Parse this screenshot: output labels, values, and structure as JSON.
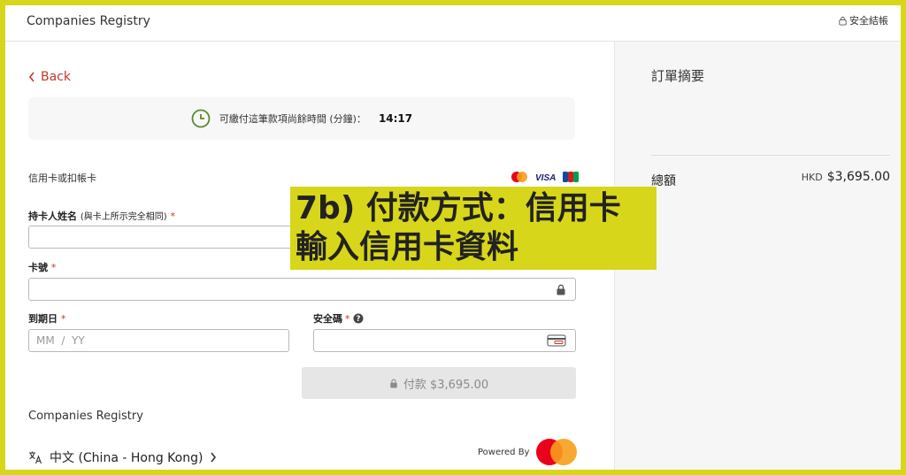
{
  "header": {
    "title": "Companies Registry",
    "secure_label": "安全結帳"
  },
  "nav": {
    "back_label": "Back"
  },
  "timer": {
    "text": "可繳付這筆款項尚餘時間 (分鐘)：",
    "value": "14:17"
  },
  "payment": {
    "section_label": "信用卡或扣帳卡",
    "card_brands": [
      "mastercard-icon",
      "visa-icon",
      "jcb-icon"
    ],
    "visa_text": "VISA",
    "jcb_text": "JCB",
    "cardholder_label": "持卡人姓名",
    "cardholder_sub": "(與卡上所示完全相同)",
    "card_number_label": "卡號",
    "expiry_label": "到期日",
    "expiry_placeholder": "MM  /  YY",
    "cvv_label": "安全碼",
    "required_mark": "*",
    "pay_button": "付款 $3,695.00"
  },
  "footer": {
    "company": "Companies Registry",
    "language": "中文 (China - Hong Kong)",
    "powered_by": "Powered By"
  },
  "summary": {
    "title": "訂單摘要",
    "total_label": "總額",
    "total_currency": "HKD",
    "total_amount": "$3,695.00"
  },
  "overlay": {
    "line1": "7b) 付款方式：信用卡",
    "line2": "輸入信用卡資料"
  },
  "colors": {
    "accent_red": "#c0392b",
    "timer_green": "#5a8a2e",
    "frame_yellow": "#d7d61a",
    "mastercard_red": "#eb001b",
    "mastercard_orange": "#f79e1b"
  }
}
